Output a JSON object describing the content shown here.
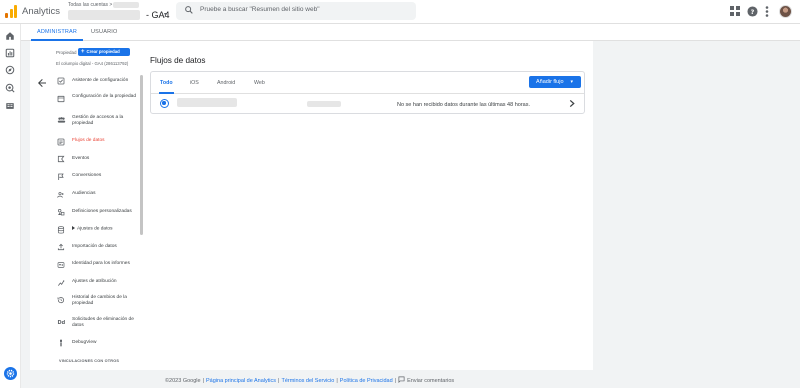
{
  "app": {
    "title": "Analytics",
    "breadcrumb": "Todas las cuentas >",
    "property_suffix": "- GA4",
    "logo_colors": [
      "#f9ab00",
      "#e37400"
    ]
  },
  "search": {
    "placeholder": "Pruebe a buscar \"Resumen del sitio web\""
  },
  "admin_tabs": [
    {
      "label": "ADMINISTRAR",
      "active": true
    },
    {
      "label": "USUARIO",
      "active": false
    }
  ],
  "property": {
    "label": "Propiedad",
    "create_button": "Crear propiedad",
    "selected": "El columpio digital - GA4 (286113792)"
  },
  "nav": {
    "items": [
      {
        "label": "Asistente de configuración",
        "icon": "checklist-icon"
      },
      {
        "label": "Configuración de la propiedad",
        "icon": "property-settings-icon"
      },
      {
        "label": "Gestión de accesos a la propiedad",
        "icon": "people-icon"
      },
      {
        "label": "Flujos de datos",
        "icon": "data-streams-icon",
        "active": true
      },
      {
        "label": "Eventos",
        "icon": "events-icon"
      },
      {
        "label": "Conversiones",
        "icon": "flag-icon"
      },
      {
        "label": "Audiencias",
        "icon": "audiences-icon"
      },
      {
        "label": "Definiciones personalizadas",
        "icon": "custom-definitions-icon"
      },
      {
        "label": "Ajustes de datos",
        "icon": "database-icon",
        "expandable": true
      },
      {
        "label": "Importación de datos",
        "icon": "upload-icon"
      },
      {
        "label": "Identidad para los informes",
        "icon": "identity-icon"
      },
      {
        "label": "Ajustes de atribución",
        "icon": "attribution-icon"
      },
      {
        "label": "Historial de cambios de la propiedad",
        "icon": "history-icon"
      },
      {
        "label": "Solicitudes de eliminación de datos",
        "icon": "dd-icon"
      },
      {
        "label": "DebugView",
        "icon": "debug-icon"
      }
    ],
    "section_label": "VINCULACIONES CON OTROS"
  },
  "data_streams": {
    "title": "Flujos de datos",
    "tabs": [
      {
        "label": "Todo",
        "active": true
      },
      {
        "label": "iOS",
        "active": false
      },
      {
        "label": "Android",
        "active": false
      },
      {
        "label": "Web",
        "active": false
      }
    ],
    "add_button": "Añadir flujo",
    "streams": [
      {
        "status": "No se han recibido datos durante las últimas 48 horas."
      }
    ]
  },
  "footer": {
    "copyright": "©2023 Google",
    "links": [
      "Página principal de Analytics",
      "Términos del Servicio",
      "Política de Privacidad"
    ],
    "feedback": "Enviar comentarios"
  },
  "colors": {
    "accent": "#1a73e8",
    "active_nav": "#ea4335"
  }
}
